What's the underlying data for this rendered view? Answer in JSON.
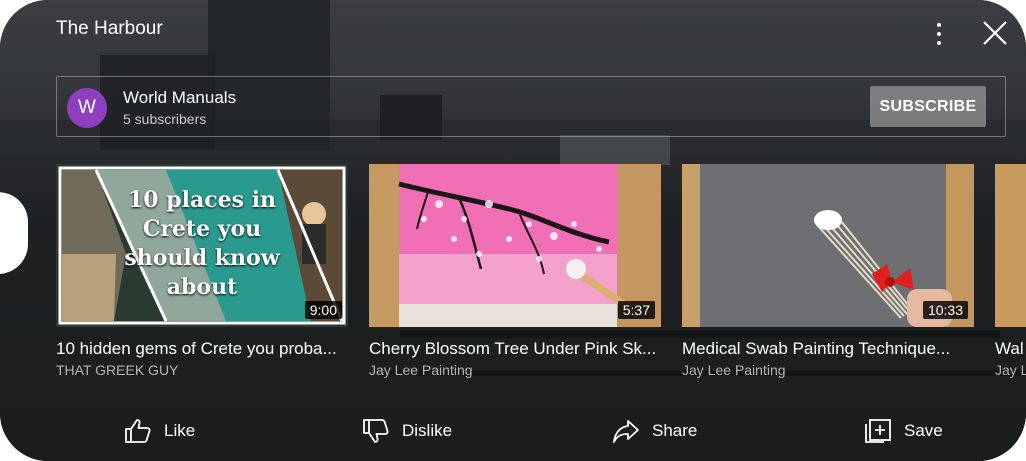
{
  "header": {
    "title": "The Harbour"
  },
  "channel": {
    "avatar_letter": "W",
    "name": "World Manuals",
    "subscribers": "5 subscribers",
    "subscribe_label": "SUBSCRIBE",
    "avatar_color": "#8e3fbf"
  },
  "videos": [
    {
      "thumb_text": "10 places in Crete you should know about",
      "duration": "9:00",
      "title": "10 hidden gems of Crete you proba...",
      "channel": "THAT GREEK GUY"
    },
    {
      "duration": "5:37",
      "title": "Cherry Blossom Tree Under Pink Sk...",
      "channel": "Jay Lee Painting"
    },
    {
      "duration": "10:33",
      "title": "Medical Swab Painting Technique...",
      "channel": "Jay Lee Painting"
    },
    {
      "title": "Wal",
      "channel": "Jay L"
    }
  ],
  "actions": {
    "like": "Like",
    "dislike": "Dislike",
    "share": "Share",
    "save": "Save"
  },
  "icons": {
    "menu": "more-vert-icon",
    "close": "close-icon",
    "like": "thumbs-up-icon",
    "dislike": "thumbs-down-icon",
    "share": "share-arrow-icon",
    "save": "add-to-playlist-icon"
  }
}
